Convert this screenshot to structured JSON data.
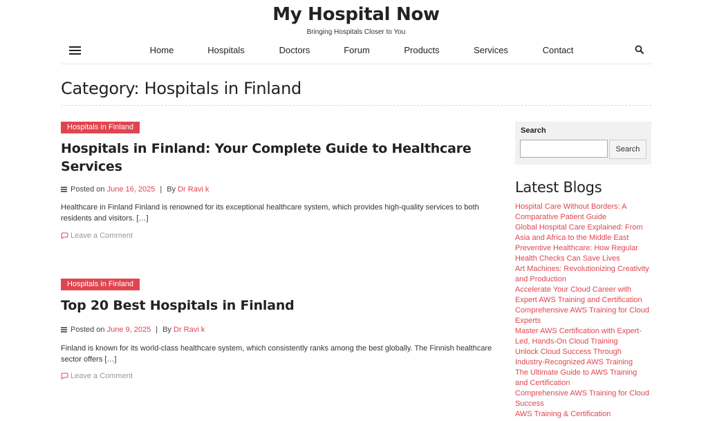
{
  "header": {
    "site_title": "My Hospital Now",
    "tagline": "Bringing Hospitals Closer to You"
  },
  "nav": {
    "items": [
      "Home",
      "Hospitals",
      "Doctors",
      "Forum",
      "Products",
      "Services",
      "Contact"
    ]
  },
  "page": {
    "category_title": "Category: Hospitals in Finland"
  },
  "posts": [
    {
      "category": "Hospitals in Finland",
      "title": "Hospitals in Finland: Your Complete Guide to Healthcare Services",
      "posted_on_label": "Posted on",
      "date": "June 16, 2025",
      "separator": "|",
      "by_label": "By",
      "author": "Dr Ravi k",
      "excerpt": "Healthcare in Finland Finland is renowned for its exceptional healthcare system, which provides high-quality services to both residents and visitors. […]",
      "comment_label": "Leave a Comment"
    },
    {
      "category": "Hospitals in Finland",
      "title": "Top 20 Best Hospitals in Finland",
      "posted_on_label": "Posted on",
      "date": "June 9, 2025",
      "separator": "|",
      "by_label": "By",
      "author": "Dr Ravi k",
      "excerpt": "Finland is known for its world-class healthcare system, which consistently ranks among the best globally. The Finnish healthcare sector offers […]",
      "comment_label": "Leave a Comment"
    }
  ],
  "sidebar": {
    "search_label": "Search",
    "search_value": "",
    "search_button": "Search",
    "latest_title": "Latest Blogs",
    "latest_items": [
      "Hospital Care Without Borders: A Comparative Patient Guide",
      "Global Hospital Care Explained: From Asia and Africa to the Middle East",
      "Preventive Healthcare: How Regular Health Checks Can Save Lives",
      "Art Machines: Revolutionizing Creativity and Production",
      "Accelerate Your Cloud Career with Expert AWS Training and Certification",
      "Comprehensive AWS Training for Cloud Experts",
      "Master AWS Certification with Expert-Led, Hands-On Cloud Training",
      "Unlock Cloud Success Through Industry-Recognized AWS Training",
      "The Ultimate Guide to AWS Training and Certification",
      "Comprehensive AWS Training for Cloud Success",
      "AWS Training & Certification"
    ]
  },
  "colors": {
    "accent": "#e0454f",
    "text": "#222222",
    "muted": "#999999",
    "sidebar_bg": "#f1f1f1"
  },
  "icons": {
    "menu": "hamburger-icon",
    "search": "search-icon",
    "meta": "list-icon",
    "comment": "comment-icon"
  }
}
